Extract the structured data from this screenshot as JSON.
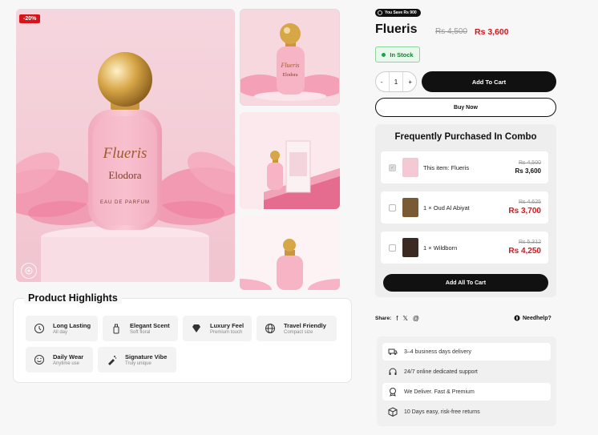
{
  "gallery": {
    "discount_badge": "-20%",
    "main_bottle": {
      "brand": "Flueris",
      "name": "Elodora",
      "type": "EAU DE PARFUM"
    },
    "thumb_bottle": {
      "brand": "Flueris",
      "name": "Elodora"
    }
  },
  "highlights": {
    "title": "Product Highlights",
    "items": [
      {
        "icon": "hourglass-icon",
        "label": "Long Lasting",
        "sub": "All day"
      },
      {
        "icon": "perfume-bottle-icon",
        "label": "Elegant Scent",
        "sub": "Soft floral"
      },
      {
        "icon": "diamond-icon",
        "label": "Luxury Feel",
        "sub": "Premium touch"
      },
      {
        "icon": "globe-icon",
        "label": "Travel Friendly",
        "sub": "Compact size"
      },
      {
        "icon": "smile-icon",
        "label": "Daily Wear",
        "sub": "Anytime use"
      },
      {
        "icon": "spray-icon",
        "label": "Signature Vibe",
        "sub": "Truly unique"
      }
    ]
  },
  "product": {
    "save_badge": "You Save Rs 900",
    "title": "Flueris",
    "old_price": "Rs 4,500",
    "new_price": "Rs 3,600",
    "stock": "In Stock",
    "qty_minus": "-",
    "qty_value": "1",
    "qty_plus": "+",
    "add_to_cart": "Add To Cart",
    "buy_now": "Buy Now"
  },
  "combo": {
    "title": "Frequently Purchased In Combo",
    "items": [
      {
        "name": "This item: Flueris",
        "old": "Rs 4,500",
        "new": "Rs 3,600",
        "color": "#f4c9d3"
      },
      {
        "name": "1 × Oud Al Abiyat",
        "old": "Rs 4,625",
        "new": "Rs 3,700",
        "color": "#7a5a35"
      },
      {
        "name": "1 × Wildborn",
        "old": "Rs 5,312",
        "new": "Rs 4,250",
        "color": "#3a2a22"
      }
    ],
    "add_all": "Add All To Cart"
  },
  "share": {
    "label": "Share:",
    "facebook": "f",
    "x": "𝕏",
    "threads": "@"
  },
  "needhelp": "Needhelp?",
  "features": [
    {
      "icon": "truck-icon",
      "text": "3–4 business days delivery"
    },
    {
      "icon": "headset-icon",
      "text": "24/7 online dedicated support"
    },
    {
      "icon": "medal-icon",
      "text": "We Deliver. Fast & Premium"
    },
    {
      "icon": "box-icon",
      "text": "10 Days easy, risk-free returns"
    }
  ],
  "colors": {
    "accent_red": "#d8141b",
    "black": "#111111",
    "pink_bg": "#f6d4dc"
  }
}
